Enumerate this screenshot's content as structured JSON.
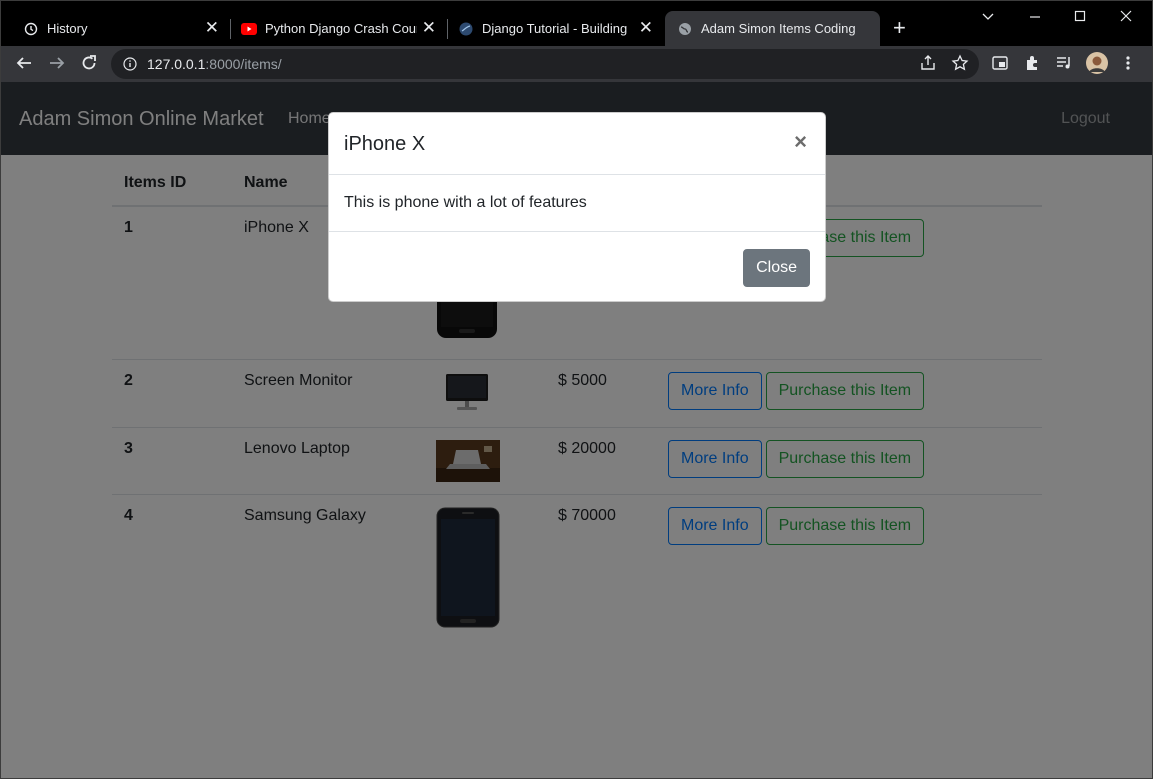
{
  "browser": {
    "tabs": [
      {
        "label": "History",
        "icon": "history-icon",
        "active": false
      },
      {
        "label": "Python Django Crash Course",
        "icon": "youtube-icon",
        "active": false
      },
      {
        "label": "Django Tutorial - Building a Marketplace",
        "icon": "django-icon",
        "active": false
      },
      {
        "label": "Adam Simon Items Coding",
        "icon": "globe-icon",
        "active": true
      }
    ],
    "url_host": "127.0.0.1",
    "url_path": ":8000/items/"
  },
  "navbar": {
    "brand": "Adam Simon Online Market",
    "home": "Home",
    "logout": "Logout"
  },
  "table": {
    "headers": [
      "Items ID",
      "Name",
      "",
      "",
      ""
    ],
    "rows": [
      {
        "id": "1",
        "name": "iPhone X",
        "price": "",
        "image": "phone-image"
      },
      {
        "id": "2",
        "name": "Screen Monitor",
        "price": "$ 5000",
        "image": "monitor-image"
      },
      {
        "id": "3",
        "name": "Lenovo Laptop",
        "price": "$ 20000",
        "image": "laptop-image"
      },
      {
        "id": "4",
        "name": "Samsung Galaxy",
        "price": "$ 70000",
        "image": "phone-image"
      }
    ],
    "more_info_label": "More Info",
    "purchase_label": "Purchase this Item"
  },
  "modal": {
    "title": "iPhone X",
    "body": "This is phone with a lot of features",
    "close_label": "Close"
  }
}
